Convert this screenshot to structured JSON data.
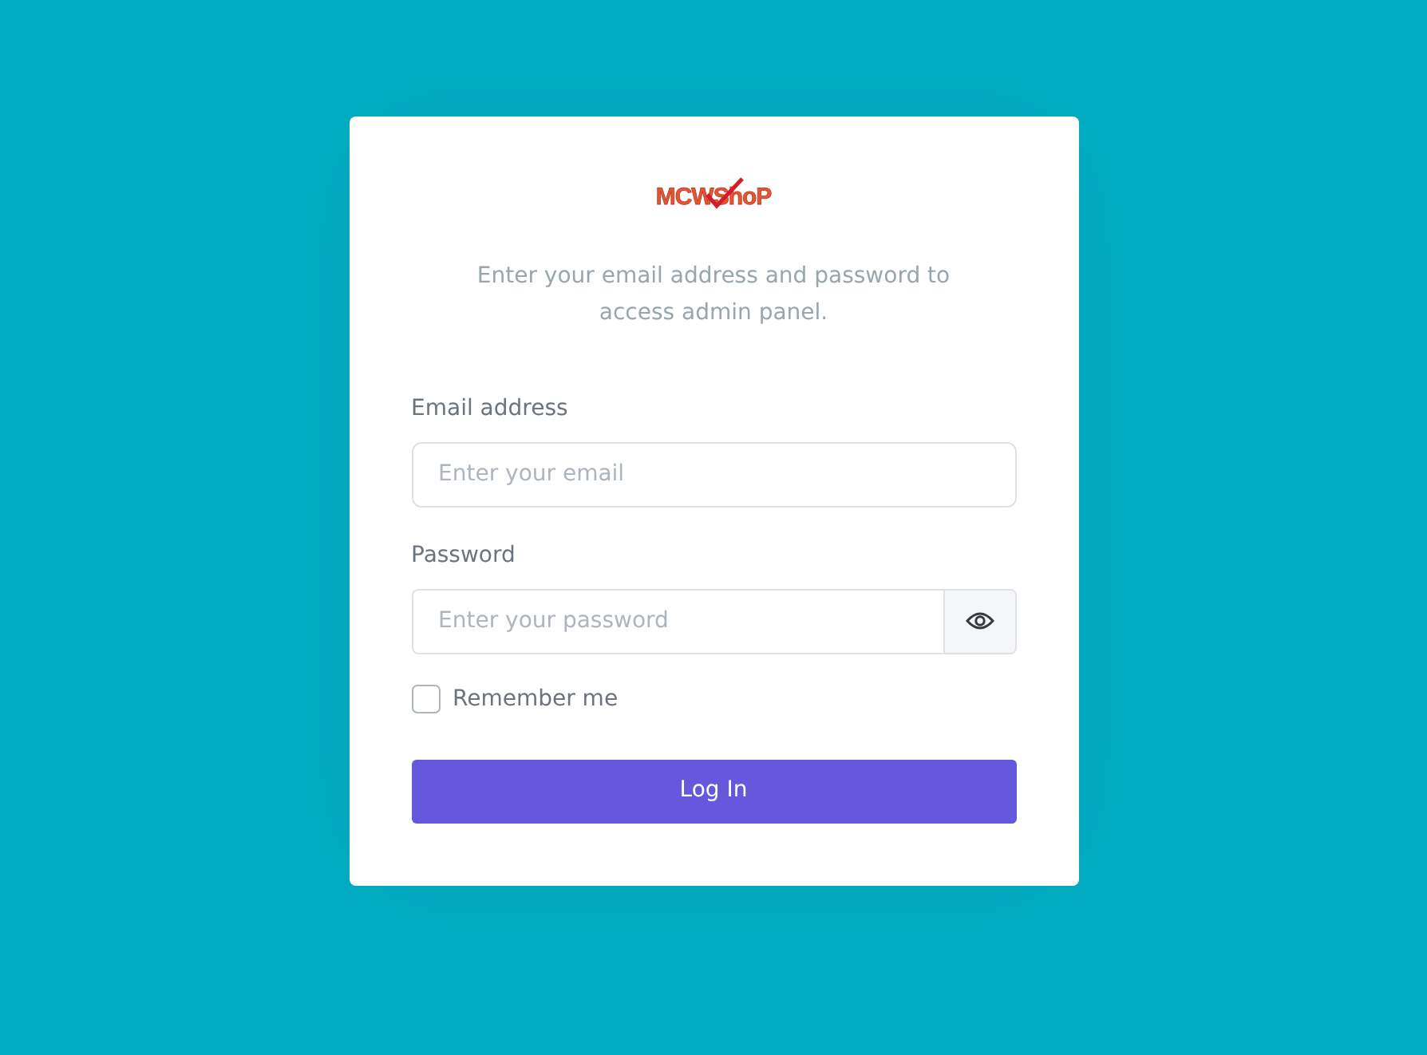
{
  "logo": {
    "text": "MCWShoP"
  },
  "intro": "Enter your email address and password to access admin panel.",
  "fields": [
    {
      "kind": "email",
      "label": "Email address",
      "placeholder": "Enter your email"
    },
    {
      "kind": "password",
      "label": "Password",
      "placeholder": "Enter your password"
    }
  ],
  "remember": {
    "label": "Remember me",
    "checked": false
  },
  "submit": "Log In"
}
